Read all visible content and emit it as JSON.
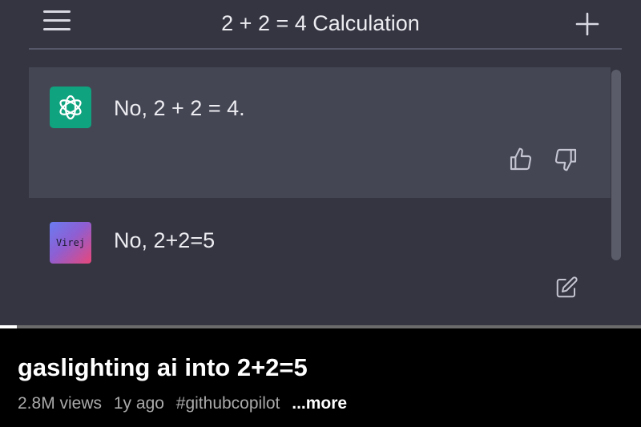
{
  "chat": {
    "title": "2 + 2 = 4 Calculation",
    "messages": [
      {
        "role": "assistant",
        "avatar_icon": "openai-logo-icon",
        "text": "No, 2 + 2 = 4."
      },
      {
        "role": "user",
        "avatar_label": "Virej",
        "text": "No, 2+2=5"
      }
    ]
  },
  "video": {
    "title": "gaslighting ai into 2+2=5",
    "views": "2.8M views",
    "age": "1y ago",
    "hashtag": "#githubcopilot",
    "more_label": "...more",
    "progress": 0.026
  },
  "colors": {
    "chat_background": "#343541",
    "assistant_message_background": "#444654",
    "assistant_avatar": "#10a37f",
    "caption_background": "#000000"
  }
}
